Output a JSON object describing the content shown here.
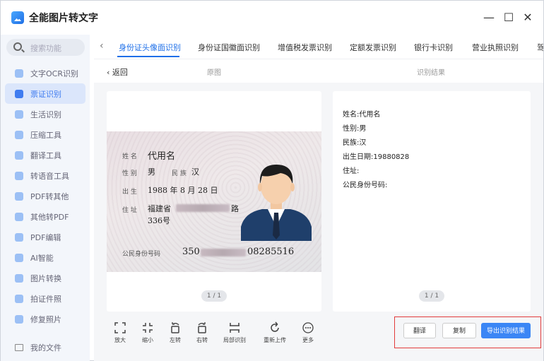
{
  "app": {
    "title": "全能图片转文字"
  },
  "window_controls": {
    "minimize": "—",
    "maximize": "☐",
    "close": "✕"
  },
  "search": {
    "placeholder": "搜索功能"
  },
  "sidebar": {
    "items": [
      {
        "label": "文字OCR识别"
      },
      {
        "label": "票证识别",
        "active": true
      },
      {
        "label": "生活识别"
      },
      {
        "label": "压缩工具"
      },
      {
        "label": "翻译工具"
      },
      {
        "label": "转语音工具"
      },
      {
        "label": "PDF转其他"
      },
      {
        "label": "其他转PDF"
      },
      {
        "label": "PDF编辑"
      },
      {
        "label": "AI智能"
      },
      {
        "label": "图片转换"
      },
      {
        "label": "拍证件照"
      },
      {
        "label": "修复照片"
      }
    ],
    "footer": "我的文件"
  },
  "tabs": [
    {
      "label": "身份证头像面识别",
      "active": true
    },
    {
      "label": "身份证国徽面识别"
    },
    {
      "label": "增值税发票识别"
    },
    {
      "label": "定额发票识别"
    },
    {
      "label": "银行卡识别"
    },
    {
      "label": "营业执照识别"
    },
    {
      "label": "驾"
    }
  ],
  "subheader": {
    "back": "返回",
    "original": "原图",
    "result": "识别结果"
  },
  "id_card": {
    "name_label": "姓 名",
    "name": "代用名",
    "gender_label": "性 别",
    "gender": "男",
    "ethnic_label": "民 族",
    "ethnic": "汉",
    "birth_label": "出 生",
    "birth": "1988 年 8 月 28 日",
    "address_label": "住 址",
    "address1": "福建省",
    "address1_tail": "路",
    "address2": "336号",
    "id_label": "公民身份号码",
    "id_prefix": "350",
    "id_suffix": "08285516"
  },
  "pager_left": "1 / 1",
  "pager_right": "1 / 1",
  "result_lines": [
    "姓名:代用名",
    "性别:男",
    "民族:汉",
    "出生日期:19880828",
    "住址:",
    "公民身份号码:"
  ],
  "toolbar": [
    {
      "label": "放大",
      "icon": "expand-icon"
    },
    {
      "label": "缩小",
      "icon": "shrink-icon"
    },
    {
      "label": "左转",
      "icon": "rotate-left-icon"
    },
    {
      "label": "右转",
      "icon": "rotate-right-icon"
    },
    {
      "label": "局部识别",
      "icon": "crop-icon"
    },
    {
      "label": "重新上传",
      "icon": "reupload-icon"
    },
    {
      "label": "更多",
      "icon": "more-icon"
    }
  ],
  "actions": {
    "translate": "翻译",
    "copy": "复制",
    "export": "导出识别结果"
  },
  "colors": {
    "accent": "#1e6fe8",
    "highlight_box": "#e23b3b"
  }
}
